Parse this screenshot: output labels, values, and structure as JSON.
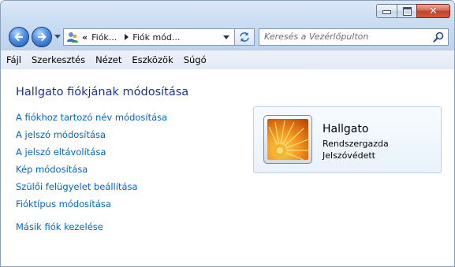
{
  "address": {
    "crumbs": [
      "Fiók...",
      "Fiók mód..."
    ]
  },
  "search": {
    "placeholder": "Keresés a Vezérlőpulton"
  },
  "menu": [
    "Fájl",
    "Szerkesztés",
    "Nézet",
    "Eszközök",
    "Súgó"
  ],
  "page": {
    "title": "Hallgato fiókjának módosítása",
    "links": [
      "A fiókhoz tartozó név módosítása",
      "A jelszó módosítása",
      "A jelszó eltávolítása",
      "Kép módosítása",
      "Szülői felügyelet beállítása",
      "Fióktípus módosítása"
    ],
    "manage_link": "Másik fiók kezelése"
  },
  "user": {
    "name": "Hallgato",
    "role": "Rendszergazda",
    "password_status": "Jelszóvédett",
    "avatar": "orange-flower"
  },
  "colors": {
    "title": "#1e3287",
    "link": "#0066cc",
    "close_button": "#c0432a"
  },
  "icons": {
    "back": "back-arrow-icon",
    "forward": "forward-arrow-icon",
    "control_panel": "control-panel-users-icon",
    "refresh": "refresh-icon",
    "search": "search-icon"
  }
}
